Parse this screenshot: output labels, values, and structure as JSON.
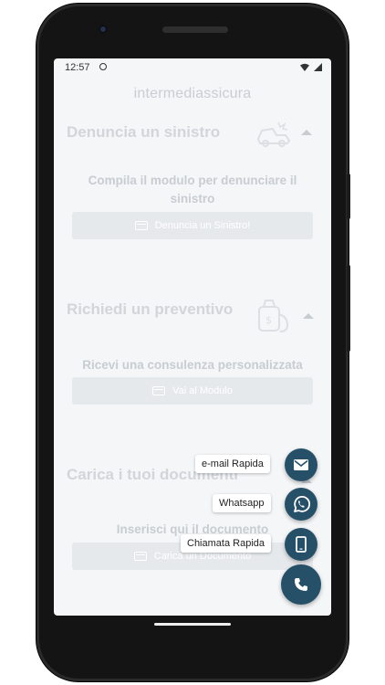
{
  "status_bar": {
    "time": "12:57"
  },
  "app": {
    "title": "intermediassicura"
  },
  "sections": [
    {
      "title": "Denuncia un sinistro",
      "description": "Compila il modulo per denunciare il sinistro",
      "button_label": "Denuncia un Sinistro!",
      "illustration_icon": "car-accident-icon"
    },
    {
      "title": "Richiedi un preventivo",
      "description": "Ricevi una consulenza personalizzata",
      "button_label": "Vai al Modulo",
      "illustration_icon": "money-bag-icon"
    },
    {
      "title": "Carica i tuoi documenti",
      "description": "Inserisci qui il documento",
      "button_label": "Carica un Documento"
    }
  ],
  "fab": {
    "actions": [
      {
        "label": "e-mail Rapida",
        "icon": "mail-icon"
      },
      {
        "label": "Whatsapp",
        "icon": "whatsapp-icon"
      },
      {
        "label": "Chiamata Rapida",
        "icon": "mobile-phone-icon"
      }
    ],
    "main_icon": "phone-icon"
  },
  "colors": {
    "fab": "#264f68",
    "background": "#f4f6f8"
  }
}
